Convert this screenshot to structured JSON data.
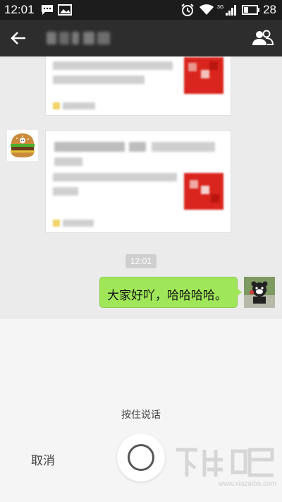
{
  "status_bar": {
    "time": "12:01",
    "battery_percent": "28"
  },
  "chat": {
    "timestamp": "12:01",
    "sent_message": "大家好吖，哈哈哈哈。"
  },
  "voice_panel": {
    "hold_to_talk": "按住说话",
    "cancel_label": "取消"
  },
  "watermark": {
    "site": "www.xiazaiba.com"
  },
  "colors": {
    "nav_bg": "#2d2d2d",
    "bubble_green": "#9fe658",
    "chat_bg": "#ebebeb"
  },
  "icons": [
    "message-icon",
    "image-icon",
    "alarm-icon",
    "wifi-icon",
    "signal-icon",
    "battery-icon",
    "back-arrow-icon",
    "group-members-icon",
    "record-icon"
  ]
}
